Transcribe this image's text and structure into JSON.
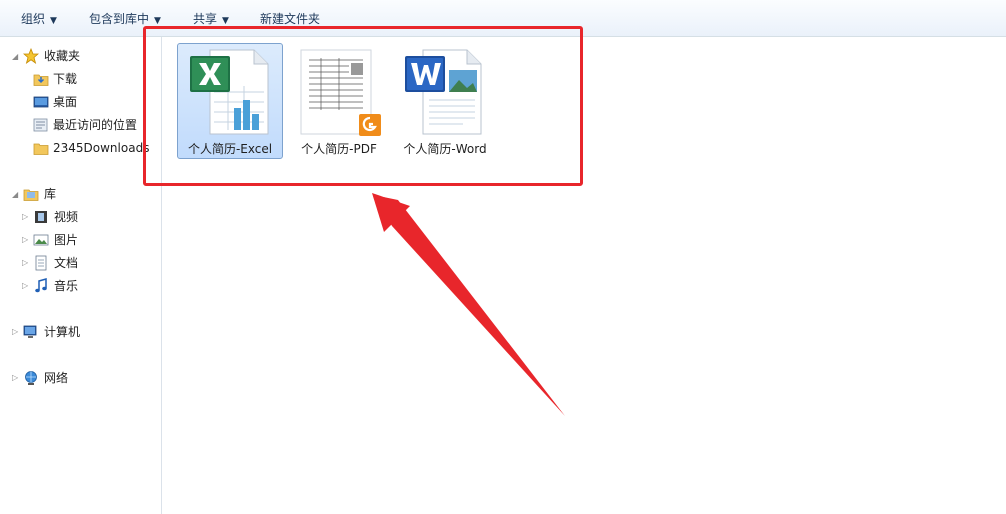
{
  "toolbar": {
    "organize": "组织",
    "include_in_library": "包含到库中",
    "share": "共享",
    "new_folder": "新建文件夹"
  },
  "nav": {
    "favorites": "收藏夹",
    "downloads": "下载",
    "desktop": "桌面",
    "recent": "最近访问的位置",
    "folder_2345": "2345Downloads",
    "libraries": "库",
    "videos": "视频",
    "pictures": "图片",
    "documents": "文档",
    "music": "音乐",
    "computer": "计算机",
    "network": "网络"
  },
  "files": [
    {
      "name": "个人简历-Excel",
      "icon": "excel-file-icon"
    },
    {
      "name": "个人简历-PDF",
      "icon": "pdf-file-icon"
    },
    {
      "name": "个人简历-Word",
      "icon": "word-file-icon"
    }
  ],
  "colors": {
    "annotation_red": "#e8262b",
    "selection": "#c1dbfc"
  }
}
